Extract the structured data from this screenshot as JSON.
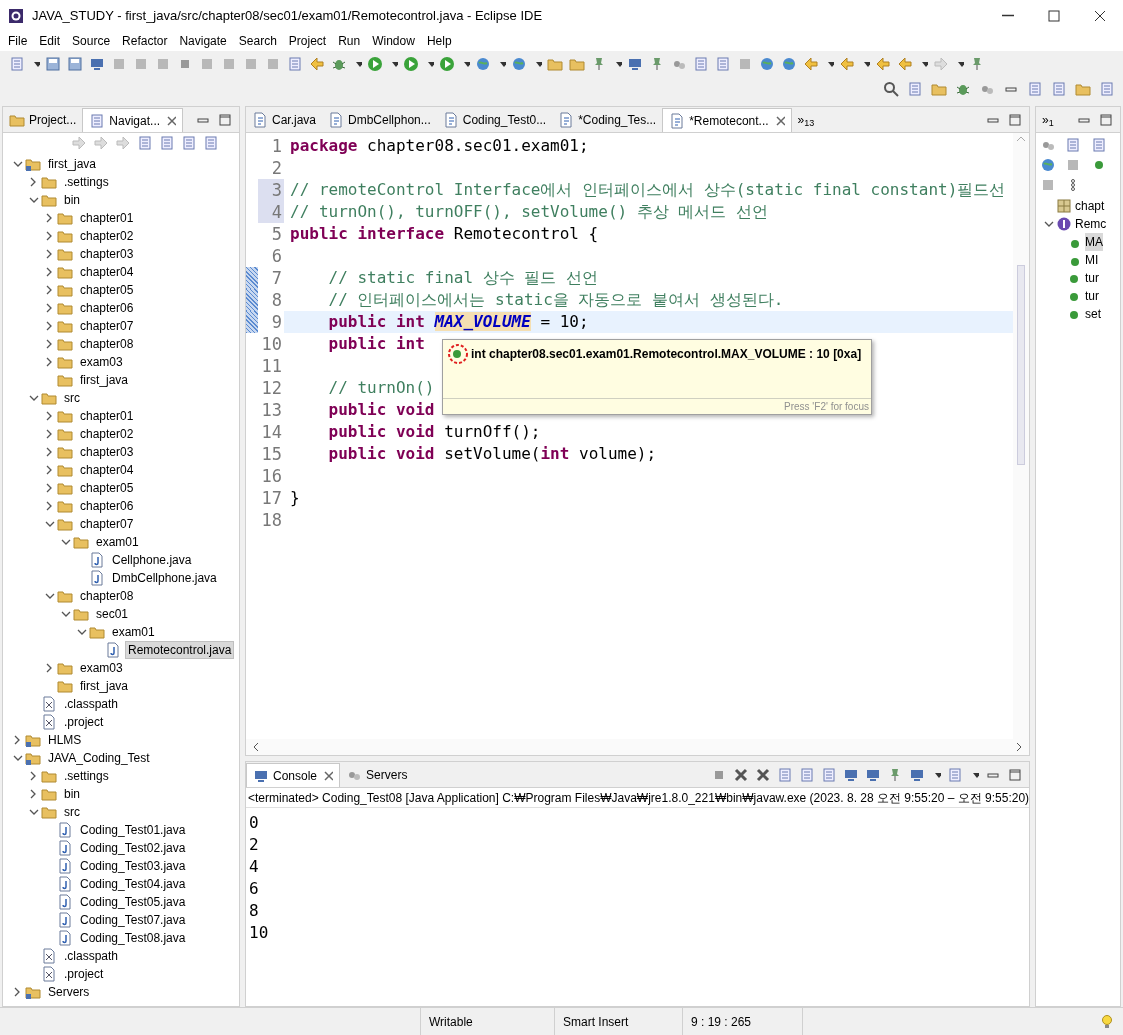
{
  "window": {
    "title": "JAVA_STUDY - first_java/src/chapter08/sec01/exam01/Remotecontrol.java - Eclipse IDE"
  },
  "menu": [
    "File",
    "Edit",
    "Source",
    "Refactor",
    "Navigate",
    "Search",
    "Project",
    "Run",
    "Window",
    "Help"
  ],
  "left_panel": {
    "tabs": [
      {
        "label": "Project...",
        "selected": false
      },
      {
        "label": "Navigat...",
        "selected": true
      }
    ],
    "tree": [
      {
        "label": "first_java",
        "kind": "project",
        "expanded": true,
        "selected": false,
        "children": [
          {
            "label": ".settings",
            "kind": "folder",
            "expanded": false,
            "selected": false
          },
          {
            "label": "bin",
            "kind": "folder",
            "expanded": true,
            "selected": false,
            "children": [
              {
                "label": "chapter01",
                "kind": "folder",
                "expanded": false,
                "selected": false
              },
              {
                "label": "chapter02",
                "kind": "folder",
                "expanded": false,
                "selected": false
              },
              {
                "label": "chapter03",
                "kind": "folder",
                "expanded": false,
                "selected": false
              },
              {
                "label": "chapter04",
                "kind": "folder",
                "expanded": false,
                "selected": false
              },
              {
                "label": "chapter05",
                "kind": "folder",
                "expanded": false,
                "selected": false
              },
              {
                "label": "chapter06",
                "kind": "folder",
                "expanded": false,
                "selected": false
              },
              {
                "label": "chapter07",
                "kind": "folder",
                "expanded": false,
                "selected": false
              },
              {
                "label": "chapter08",
                "kind": "folder",
                "expanded": false,
                "selected": false
              },
              {
                "label": "exam03",
                "kind": "folder",
                "expanded": false,
                "selected": false
              },
              {
                "label": "first_java",
                "kind": "folder",
                "selected": false
              }
            ]
          },
          {
            "label": "src",
            "kind": "folder",
            "expanded": true,
            "selected": false,
            "children": [
              {
                "label": "chapter01",
                "kind": "folder",
                "expanded": false,
                "selected": false
              },
              {
                "label": "chapter02",
                "kind": "folder",
                "expanded": false,
                "selected": false
              },
              {
                "label": "chapter03",
                "kind": "folder",
                "expanded": false,
                "selected": false
              },
              {
                "label": "chapter04",
                "kind": "folder",
                "expanded": false,
                "selected": false
              },
              {
                "label": "chapter05",
                "kind": "folder",
                "expanded": false,
                "selected": false
              },
              {
                "label": "chapter06",
                "kind": "folder",
                "expanded": false,
                "selected": false
              },
              {
                "label": "chapter07",
                "kind": "folder",
                "expanded": true,
                "selected": false,
                "children": [
                  {
                    "label": "exam01",
                    "kind": "folder",
                    "expanded": true,
                    "selected": false,
                    "children": [
                      {
                        "label": "Cellphone.java",
                        "kind": "java",
                        "selected": false
                      },
                      {
                        "label": "DmbCellphone.java",
                        "kind": "java",
                        "selected": false
                      }
                    ]
                  }
                ]
              },
              {
                "label": "chapter08",
                "kind": "folder",
                "expanded": true,
                "selected": false,
                "children": [
                  {
                    "label": "sec01",
                    "kind": "folder",
                    "expanded": true,
                    "selected": false,
                    "children": [
                      {
                        "label": "exam01",
                        "kind": "folder",
                        "expanded": true,
                        "selected": false,
                        "children": [
                          {
                            "label": "Remotecontrol.java",
                            "kind": "java",
                            "selected": true
                          }
                        ]
                      }
                    ]
                  }
                ]
              },
              {
                "label": "exam03",
                "kind": "folder",
                "expanded": false,
                "selected": false
              },
              {
                "label": "first_java",
                "kind": "folder",
                "selected": false
              }
            ]
          },
          {
            "label": ".classpath",
            "kind": "xml",
            "selected": false
          },
          {
            "label": ".project",
            "kind": "xml",
            "selected": false
          }
        ]
      },
      {
        "label": "HLMS",
        "kind": "project",
        "expanded": false,
        "selected": false
      },
      {
        "label": "JAVA_Coding_Test",
        "kind": "project",
        "expanded": true,
        "selected": false,
        "children": [
          {
            "label": ".settings",
            "kind": "folder",
            "expanded": false,
            "selected": false
          },
          {
            "label": "bin",
            "kind": "folder",
            "expanded": false,
            "selected": false
          },
          {
            "label": "src",
            "kind": "folder",
            "expanded": true,
            "selected": false,
            "children": [
              {
                "label": "Coding_Test01.java",
                "kind": "java",
                "selected": false
              },
              {
                "label": "Coding_Test02.java",
                "kind": "java",
                "selected": false
              },
              {
                "label": "Coding_Test03.java",
                "kind": "java",
                "selected": false
              },
              {
                "label": "Coding_Test04.java",
                "kind": "java",
                "selected": false
              },
              {
                "label": "Coding_Test05.java",
                "kind": "java",
                "selected": false
              },
              {
                "label": "Coding_Test07.java",
                "kind": "java",
                "selected": false
              },
              {
                "label": "Coding_Test08.java",
                "kind": "java",
                "selected": false
              }
            ]
          },
          {
            "label": ".classpath",
            "kind": "xml",
            "selected": false
          },
          {
            "label": ".project",
            "kind": "xml",
            "selected": false
          }
        ]
      },
      {
        "label": "Servers",
        "kind": "project",
        "expanded": false,
        "selected": false
      }
    ]
  },
  "editor": {
    "tabs": [
      {
        "label": "Car.java",
        "selected": false
      },
      {
        "label": "DmbCellphon...",
        "selected": false
      },
      {
        "label": "Coding_Test0...",
        "selected": false
      },
      {
        "label": "*Coding_Tes...",
        "selected": false
      },
      {
        "label": "*Remotecont...",
        "selected": true
      }
    ],
    "overflow": "»$_{13}$",
    "lines": [
      {
        "number": "1",
        "segments": [
          {
            "text": "package",
            "kind": "keyword"
          },
          {
            "text": " chapter08.sec01.exam01;",
            "kind": "plain"
          }
        ]
      },
      {
        "number": "2"
      },
      {
        "number": "3",
        "shaded": true,
        "segments": [
          {
            "text": "// remoteControl Interface에서 인터페이스에서 상수(static final constant)필드선",
            "kind": "comment"
          }
        ]
      },
      {
        "number": "4",
        "shaded": true,
        "segments": [
          {
            "text": "// turnOn(), turnOFF(), setVolume() 추상 메서드 선언",
            "kind": "comment"
          }
        ]
      },
      {
        "number": "5",
        "segments": [
          {
            "text": "public interface",
            "kind": "keyword"
          },
          {
            "text": " Remotecontrol {",
            "kind": "plain"
          }
        ]
      },
      {
        "number": "6"
      },
      {
        "number": "7",
        "changed": true,
        "segments": [
          {
            "text": "    // static final 상수 필드 선언",
            "kind": "comment"
          }
        ]
      },
      {
        "number": "8",
        "changed": true,
        "segments": [
          {
            "text": "    // 인터페이스에서는 static을 자동으로 붙여서 생성된다.",
            "kind": "comment"
          }
        ]
      },
      {
        "number": "9",
        "changed": true,
        "current": true,
        "segments": [
          {
            "text": "    public int ",
            "kind": "keyword"
          },
          {
            "text": "MAX_VOLUME",
            "kind": "field",
            "highlighted": true
          },
          {
            "text": " = 10;",
            "kind": "plain"
          }
        ]
      },
      {
        "number": "10",
        "segments": [
          {
            "text": "    public int",
            "kind": "keyword"
          }
        ]
      },
      {
        "number": "11"
      },
      {
        "number": "12",
        "segments": [
          {
            "text": "    // turnOn()",
            "kind": "comment"
          }
        ]
      },
      {
        "number": "13",
        "segments": [
          {
            "text": "    public void",
            "kind": "keyword"
          }
        ]
      },
      {
        "number": "14",
        "segments": [
          {
            "text": "    public void",
            "kind": "keyword"
          },
          {
            "text": " turnOff();",
            "kind": "plain"
          }
        ]
      },
      {
        "number": "15",
        "segments": [
          {
            "text": "    public void",
            "kind": "keyword"
          },
          {
            "text": " setVolume(",
            "kind": "plain"
          },
          {
            "text": "int",
            "kind": "keyword"
          },
          {
            "text": " volume);",
            "kind": "plain"
          }
        ]
      },
      {
        "number": "16"
      },
      {
        "number": "17",
        "segments": [
          {
            "text": "}",
            "kind": "plain"
          }
        ]
      },
      {
        "number": "18"
      }
    ],
    "tooltip": {
      "text": "int chapter08.sec01.exam01.Remotecontrol.MAX_VOLUME : 10 [0xa]",
      "hint": "Press 'F2' for focus"
    }
  },
  "outline": {
    "overflow": "»$_{1}$",
    "items": [
      {
        "label": "chapt",
        "kind": "package",
        "selected": false
      },
      {
        "label": "Remc",
        "kind": "interface",
        "expanded": true,
        "selected": false,
        "children": [
          {
            "label": "MA",
            "kind": "constant",
            "selected": true
          },
          {
            "label": "MI",
            "kind": "constant",
            "selected": false
          },
          {
            "label": "tur",
            "kind": "method",
            "selected": false
          },
          {
            "label": "tur",
            "kind": "method",
            "selected": false
          },
          {
            "label": "set",
            "kind": "method",
            "selected": false
          }
        ]
      }
    ]
  },
  "console": {
    "tabs": [
      {
        "label": "Console",
        "selected": true
      },
      {
        "label": "Servers",
        "selected": false
      }
    ],
    "header": "<terminated> Coding_Test08 [Java Application] C:₩Program Files₩Java₩jre1.8.0_221₩bin₩javaw.exe  (2023. 8. 28 오전 9:55:20 – 오전 9:55:20)",
    "output": [
      "0",
      "2",
      "4",
      "6",
      "8",
      "10"
    ]
  },
  "status_bar": [
    "Writable",
    "Smart Insert",
    "9 : 19 : 265"
  ]
}
